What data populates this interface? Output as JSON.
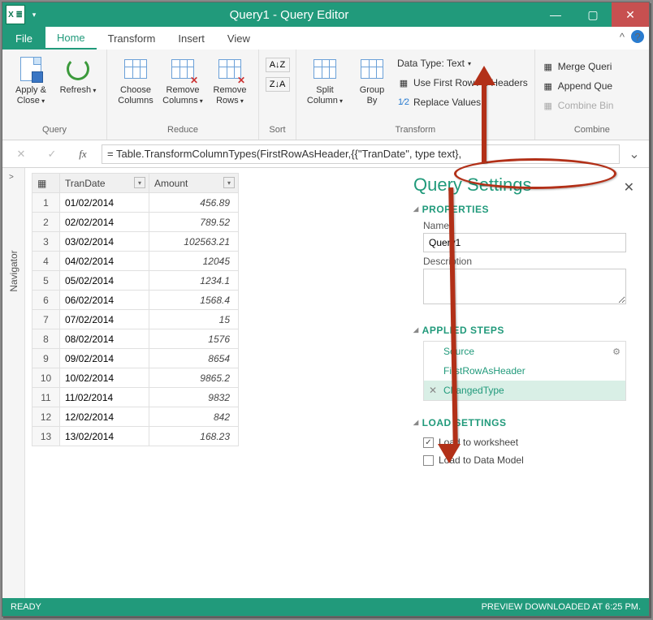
{
  "window": {
    "app_glyph": "X ≣",
    "title": "Query1 - Query Editor",
    "min": "—",
    "max": "▢",
    "close": "✕"
  },
  "tabs": {
    "file": "File",
    "items": [
      "Home",
      "Transform",
      "Insert",
      "View"
    ],
    "active_index": 0,
    "collapse": "^",
    "help": "?"
  },
  "ribbon": {
    "query": {
      "title": "Query",
      "apply_close": "Apply &\nClose",
      "refresh": "Refresh"
    },
    "reduce": {
      "title": "Reduce",
      "choose": "Choose\nColumns",
      "remove_cols": "Remove\nColumns",
      "remove_rows": "Remove\nRows"
    },
    "sort": {
      "title": "Sort",
      "asc": "A↓Z",
      "desc": "Z↓A"
    },
    "transform": {
      "title": "Transform",
      "split": "Split\nColumn",
      "group": "Group\nBy",
      "data_type": "Data Type: Text",
      "first_row": "Use First Row As Headers",
      "replace": "Replace Values",
      "replace_prefix": "1⁄2"
    },
    "combine": {
      "title": "Combine",
      "merge": "Merge Queri",
      "append": "Append Que",
      "combine_bin": "Combine Bin"
    }
  },
  "formula": {
    "cancel": "✕",
    "accept": "✓",
    "fx": "fx",
    "text": "= Table.TransformColumnTypes(FirstRowAsHeader,{{\"TranDate\", type text},",
    "expand": "⌄"
  },
  "navigator": {
    "label": "Navigator",
    "chevron": ">"
  },
  "grid": {
    "corner": "▦",
    "columns": [
      {
        "name": "TranDate",
        "filter": "▾"
      },
      {
        "name": "Amount",
        "filter": "▾"
      }
    ],
    "rows": [
      {
        "n": 1,
        "date": "01/02/2014",
        "amount": "456.89"
      },
      {
        "n": 2,
        "date": "02/02/2014",
        "amount": "789.52"
      },
      {
        "n": 3,
        "date": "03/02/2014",
        "amount": "102563.21"
      },
      {
        "n": 4,
        "date": "04/02/2014",
        "amount": "12045"
      },
      {
        "n": 5,
        "date": "05/02/2014",
        "amount": "1234.1"
      },
      {
        "n": 6,
        "date": "06/02/2014",
        "amount": "1568.4"
      },
      {
        "n": 7,
        "date": "07/02/2014",
        "amount": "15"
      },
      {
        "n": 8,
        "date": "08/02/2014",
        "amount": "1576"
      },
      {
        "n": 9,
        "date": "09/02/2014",
        "amount": "8654"
      },
      {
        "n": 10,
        "date": "10/02/2014",
        "amount": "9865.2"
      },
      {
        "n": 11,
        "date": "11/02/2014",
        "amount": "9832"
      },
      {
        "n": 12,
        "date": "12/02/2014",
        "amount": "842"
      },
      {
        "n": 13,
        "date": "13/02/2014",
        "amount": "168.23"
      }
    ]
  },
  "settings": {
    "title": "Query Settings",
    "close": "✕",
    "properties": {
      "heading": "PROPERTIES",
      "name_label": "Name",
      "name_value": "Query1",
      "desc_label": "Description",
      "desc_value": ""
    },
    "steps": {
      "heading": "APPLIED STEPS",
      "items": [
        {
          "name": "Source",
          "gear": true,
          "del": false,
          "selected": false
        },
        {
          "name": "FirstRowAsHeader",
          "gear": false,
          "del": false,
          "selected": false
        },
        {
          "name": "ChangedType",
          "gear": false,
          "del": true,
          "selected": true
        }
      ]
    },
    "load": {
      "heading": "LOAD SETTINGS",
      "worksheet": {
        "label": "Load to worksheet",
        "checked": true
      },
      "datamodel": {
        "label": "Load to Data Model",
        "checked": false
      }
    }
  },
  "status": {
    "left": "READY",
    "right": "PREVIEW DOWNLOADED AT 6:25 PM."
  },
  "colors": {
    "brand": "#219a7b",
    "annotation": "#b23018"
  }
}
